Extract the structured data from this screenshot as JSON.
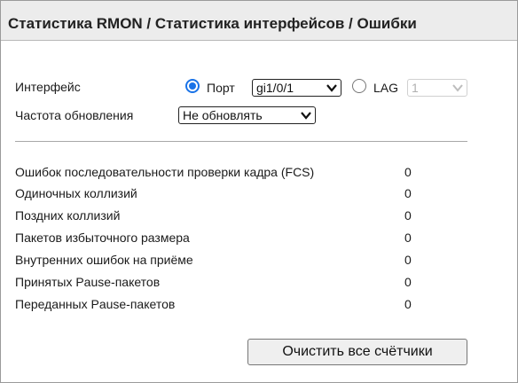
{
  "header": {
    "title": "Статистика RMON / Статистика интерфейсов / Ошибки"
  },
  "form": {
    "interface_label": "Интерфейс",
    "port_radio_label": "Порт",
    "port_selected": "gi1/0/1",
    "lag_radio_label": "LAG",
    "lag_selected": "1",
    "refresh_label": "Частота обновления",
    "refresh_selected": "Не обновлять"
  },
  "stats": [
    {
      "label": "Ошибок последовательности проверки кадра (FCS)",
      "value": "0"
    },
    {
      "label": "Одиночных коллизий",
      "value": "0"
    },
    {
      "label": "Поздних коллизий",
      "value": "0"
    },
    {
      "label": "Пакетов избыточного размера",
      "value": "0"
    },
    {
      "label": "Внутренних ошибок на приёме",
      "value": "0"
    },
    {
      "label": "Принятых Pause-пакетов",
      "value": "0"
    },
    {
      "label": "Переданных Pause-пакетов",
      "value": "0"
    }
  ],
  "actions": {
    "clear_all_label": "Очистить все счётчики"
  },
  "colors": {
    "accent": "#1a73e8",
    "header_bg": "#ececec"
  },
  "icons": {
    "dropdown": "chevron-down-icon"
  }
}
